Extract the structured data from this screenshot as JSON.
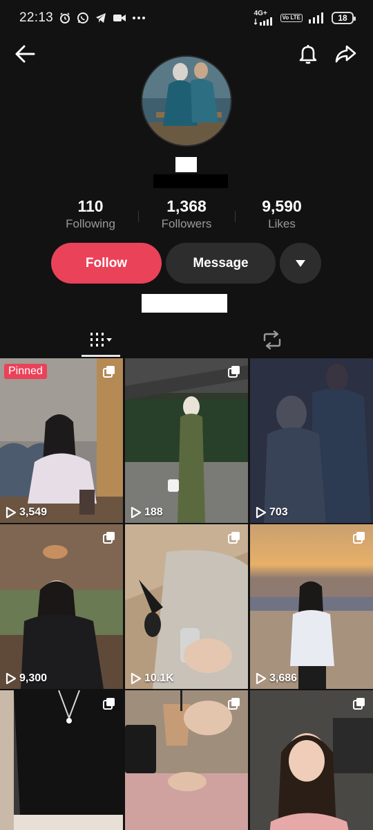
{
  "status_bar": {
    "time": "22:13",
    "network": "4G+",
    "volte": "Vo LTE",
    "battery": "18"
  },
  "profile": {
    "stats": [
      {
        "value": "110",
        "label": "Following"
      },
      {
        "value": "1,368",
        "label": "Followers"
      },
      {
        "value": "9,590",
        "label": "Likes"
      }
    ]
  },
  "actions": {
    "follow_label": "Follow",
    "message_label": "Message"
  },
  "videos": [
    {
      "views": "3,549",
      "pinned_label": "Pinned"
    },
    {
      "views": "188"
    },
    {
      "views": "703"
    },
    {
      "views": "9,300"
    },
    {
      "views": "10.1K"
    },
    {
      "views": "3,686"
    },
    {
      "views": ""
    },
    {
      "views": ""
    },
    {
      "views": ""
    }
  ],
  "colors": {
    "background": "#121212",
    "accent": "#ea4259",
    "secondary_button": "#2d2d2d",
    "muted_text": "#9a9a9a"
  }
}
